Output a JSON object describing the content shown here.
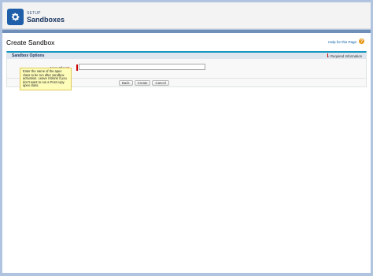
{
  "header": {
    "eyebrow": "SETUP",
    "title": "Sandboxes",
    "icon": "gear-icon"
  },
  "page": {
    "title": "Create Sandbox",
    "help_link": "Help for this Page",
    "help_icon": "help-icon"
  },
  "section": {
    "title": "Sandbox Options",
    "required_info": "= Required Information"
  },
  "form": {
    "apex_label": "Apex Class",
    "apex_value": "",
    "tooltip": "Enter the name of the apex class to be run after sandbox activation. Leave it blank if you don't want to run a Post copy apex class."
  },
  "buttons": {
    "back": "Back",
    "create": "Create",
    "cancel": "Cancel"
  },
  "colors": {
    "accent": "#1797c0",
    "header_icon_bg": "#1f5ea8",
    "required": "#cc0000",
    "tooltip_bg": "#fefdb9"
  }
}
